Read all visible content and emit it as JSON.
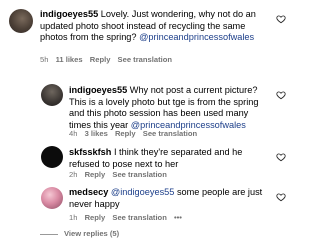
{
  "comments": [
    {
      "username": "indigoeyes55",
      "text": " Lovely. Just wondering, why not do an updated photo shoot instead of recycling the same photos from the spring? ",
      "mention": "@princeandprincessofwales",
      "time": "5h",
      "likes": "11 likes",
      "reply": "Reply",
      "translate": "See translation"
    },
    {
      "username": "indigoeyes55",
      "text": " Why not post a current picture? This is a lovely photo but tge is from the spring and this photo session has been used many times this year ",
      "mention": "@princeandprincessofwales",
      "time": "4h",
      "likes": "3 likes",
      "reply": "Reply",
      "translate": "See translation"
    },
    {
      "username": "skfsskfsh",
      "text": " I think they're separated and he refused to pose next to her",
      "time": "2h",
      "reply": "Reply",
      "translate": "See translation"
    },
    {
      "username": "medsecy",
      "mention": "@indigoeyes55",
      "text": " some people are just never happy",
      "time": "1h",
      "reply": "Reply",
      "translate": "See translation",
      "more": "•••"
    }
  ],
  "view_replies": "View replies (5)"
}
